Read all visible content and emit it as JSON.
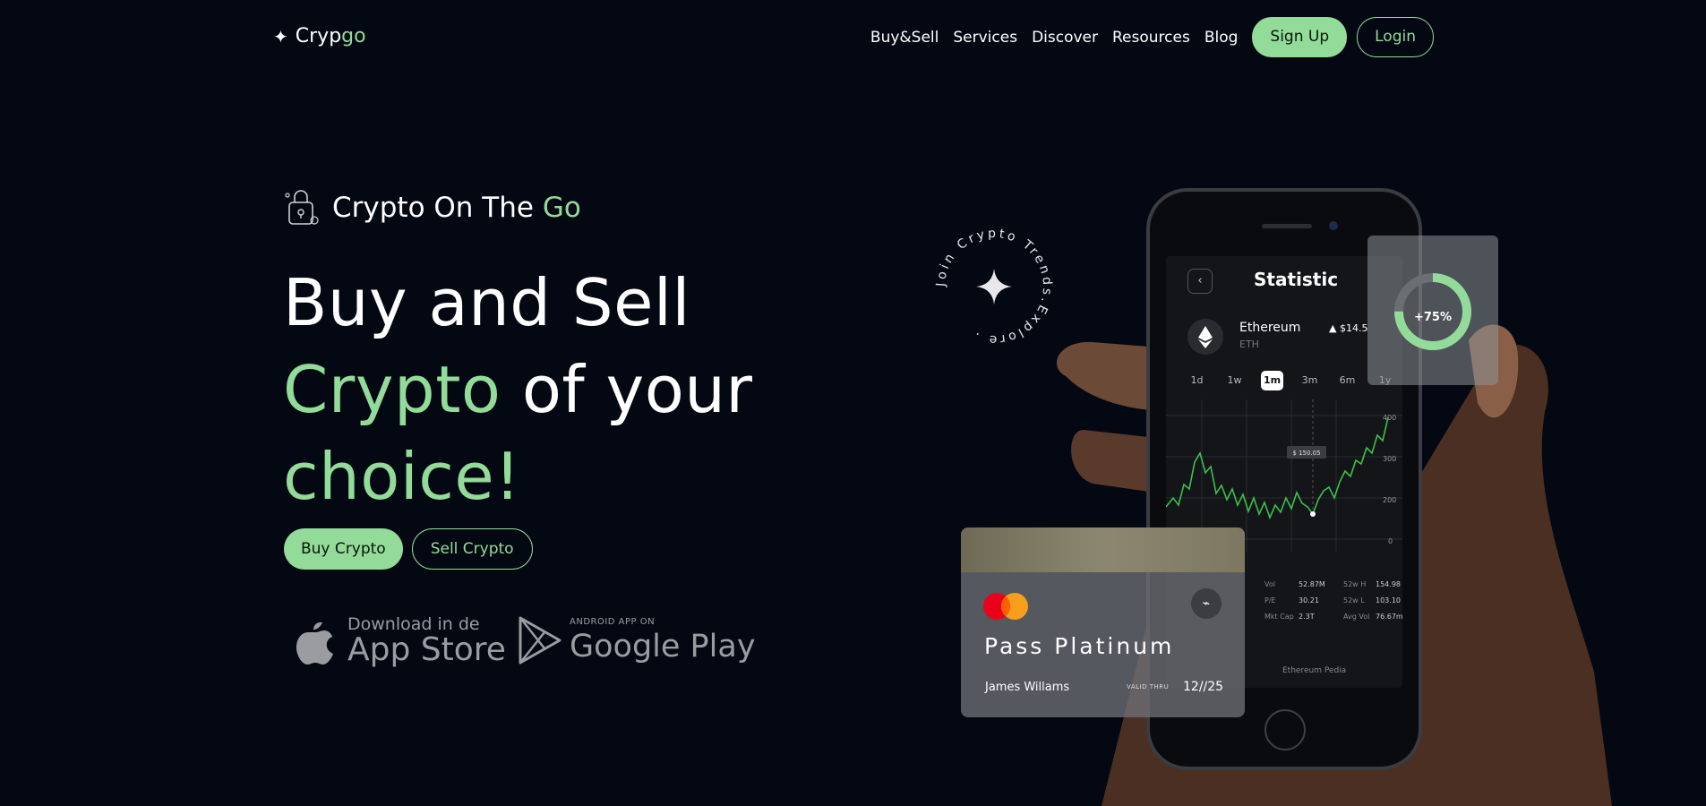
{
  "brand": {
    "name_part1": "Cryp",
    "name_part2": "go",
    "star": "✦",
    "accent": "#93db98",
    "background": "#040813"
  },
  "nav": {
    "links": [
      "Buy&Sell",
      "Services",
      "Discover",
      "Resources",
      "Blog"
    ],
    "signup": "Sign Up",
    "login": "Login"
  },
  "hero": {
    "tagline_prefix": "Crypto On The ",
    "tagline_accent": "Go",
    "tagline_icon": "wallet-lock-icon",
    "headline_line1": "Buy and Sell",
    "headline_line2_accent": "Crypto",
    "headline_line2_rest": " of your",
    "headline_line3_accent": "choice!",
    "buy_button": "Buy Crypto",
    "sell_button": "Sell Crypto"
  },
  "stores": {
    "apple_small": "Download in de",
    "apple_big": "App Store",
    "google_small": "ANDROID APP ON",
    "google_big": "Google Play"
  },
  "badge": {
    "circular_text": "Join Crypto Trends.Explore ."
  },
  "phone": {
    "screen_title": "Statistic",
    "coin_name": "Ethereum",
    "coin_symbol": "ETH",
    "coin_price": "▲ $14.5",
    "ranges": [
      "1d",
      "1w",
      "1m",
      "3m",
      "6m",
      "1y"
    ],
    "active_range": "1m",
    "tooltip": "$ 150.05",
    "y_ticks": [
      "400",
      "300",
      "200",
      "0"
    ],
    "stats": [
      {
        "label": "Vol",
        "value": "52.87M",
        "label2": "52w H",
        "value2": "154.98"
      },
      {
        "label": "P/E",
        "value": "30.21",
        "label2": "52w L",
        "value2": "103.10"
      },
      {
        "label": "Mkt Cap",
        "value": "2.3T",
        "label2": "Avg Vol",
        "value2": "76.67m"
      }
    ],
    "footer": "Ethereum Pedia"
  },
  "gauge": {
    "label": "+75%",
    "value": 0.75
  },
  "card": {
    "name": "Pass Platinum",
    "holder": "James Willams",
    "valid_label": "VALID THRU",
    "valid_date": "12//25"
  }
}
